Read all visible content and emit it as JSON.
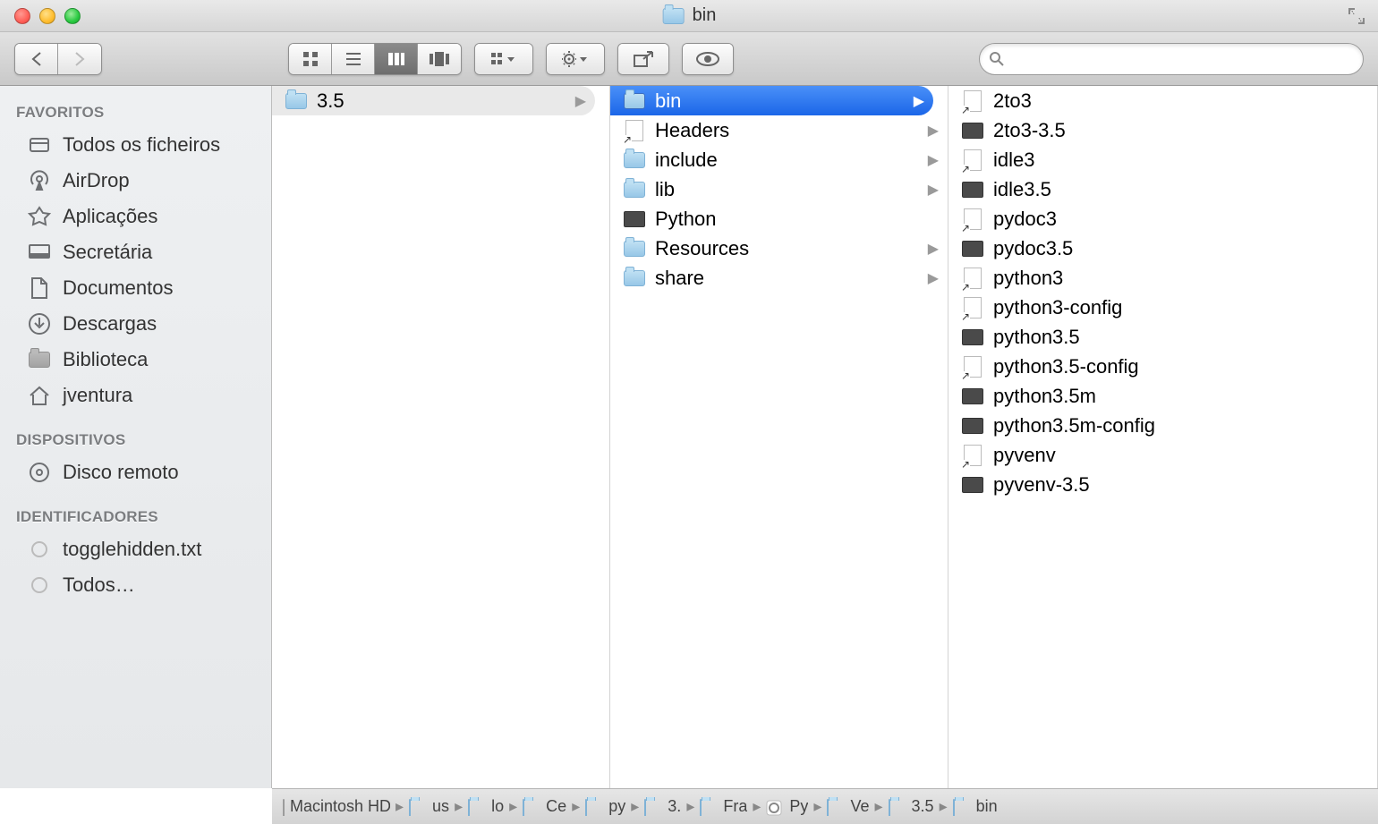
{
  "window": {
    "title": "bin"
  },
  "search": {
    "placeholder": ""
  },
  "sidebar": {
    "sections": [
      {
        "heading": "FAVORITOS",
        "items": [
          {
            "label": "Todos os ficheiros",
            "icon": "all-files"
          },
          {
            "label": "AirDrop",
            "icon": "airdrop"
          },
          {
            "label": "Aplicações",
            "icon": "apps"
          },
          {
            "label": "Secretária",
            "icon": "desktop"
          },
          {
            "label": "Documentos",
            "icon": "documents"
          },
          {
            "label": "Descargas",
            "icon": "downloads"
          },
          {
            "label": "Biblioteca",
            "icon": "folder"
          },
          {
            "label": "jventura",
            "icon": "home"
          }
        ]
      },
      {
        "heading": "DISPOSITIVOS",
        "items": [
          {
            "label": "Disco remoto",
            "icon": "remote-disc"
          }
        ]
      },
      {
        "heading": "IDENTIFICADORES",
        "items": [
          {
            "label": "togglehidden.txt",
            "icon": "tag"
          },
          {
            "label": "Todos…",
            "icon": "tag"
          }
        ]
      }
    ]
  },
  "columns": [
    {
      "items": [
        {
          "label": "3.5",
          "icon": "folder",
          "hasChildren": true,
          "state": "open"
        }
      ]
    },
    {
      "items": [
        {
          "label": "bin",
          "icon": "folder",
          "hasChildren": true,
          "state": "selected"
        },
        {
          "label": "Headers",
          "icon": "link",
          "hasChildren": true
        },
        {
          "label": "include",
          "icon": "folder",
          "hasChildren": true
        },
        {
          "label": "lib",
          "icon": "folder",
          "hasChildren": true
        },
        {
          "label": "Python",
          "icon": "exec",
          "hasChildren": false
        },
        {
          "label": "Resources",
          "icon": "folder",
          "hasChildren": true
        },
        {
          "label": "share",
          "icon": "folder",
          "hasChildren": true
        }
      ]
    },
    {
      "items": [
        {
          "label": "2to3",
          "icon": "link"
        },
        {
          "label": "2to3-3.5",
          "icon": "exec"
        },
        {
          "label": "idle3",
          "icon": "link"
        },
        {
          "label": "idle3.5",
          "icon": "exec"
        },
        {
          "label": "pydoc3",
          "icon": "link"
        },
        {
          "label": "pydoc3.5",
          "icon": "exec"
        },
        {
          "label": "python3",
          "icon": "link"
        },
        {
          "label": "python3-config",
          "icon": "link"
        },
        {
          "label": "python3.5",
          "icon": "exec"
        },
        {
          "label": "python3.5-config",
          "icon": "link"
        },
        {
          "label": "python3.5m",
          "icon": "exec"
        },
        {
          "label": "python3.5m-config",
          "icon": "exec"
        },
        {
          "label": "pyvenv",
          "icon": "link"
        },
        {
          "label": "pyvenv-3.5",
          "icon": "exec"
        }
      ]
    }
  ],
  "path": [
    {
      "label": "Macintosh HD",
      "icon": "hd"
    },
    {
      "label": "us",
      "icon": "folder"
    },
    {
      "label": "lo",
      "icon": "folder"
    },
    {
      "label": "Ce",
      "icon": "folder"
    },
    {
      "label": "py",
      "icon": "folder"
    },
    {
      "label": "3.",
      "icon": "folder"
    },
    {
      "label": "Fra",
      "icon": "folder"
    },
    {
      "label": "Py",
      "icon": "framework"
    },
    {
      "label": "Ve",
      "icon": "folder"
    },
    {
      "label": "3.5",
      "icon": "folder"
    },
    {
      "label": "bin",
      "icon": "folder"
    }
  ]
}
